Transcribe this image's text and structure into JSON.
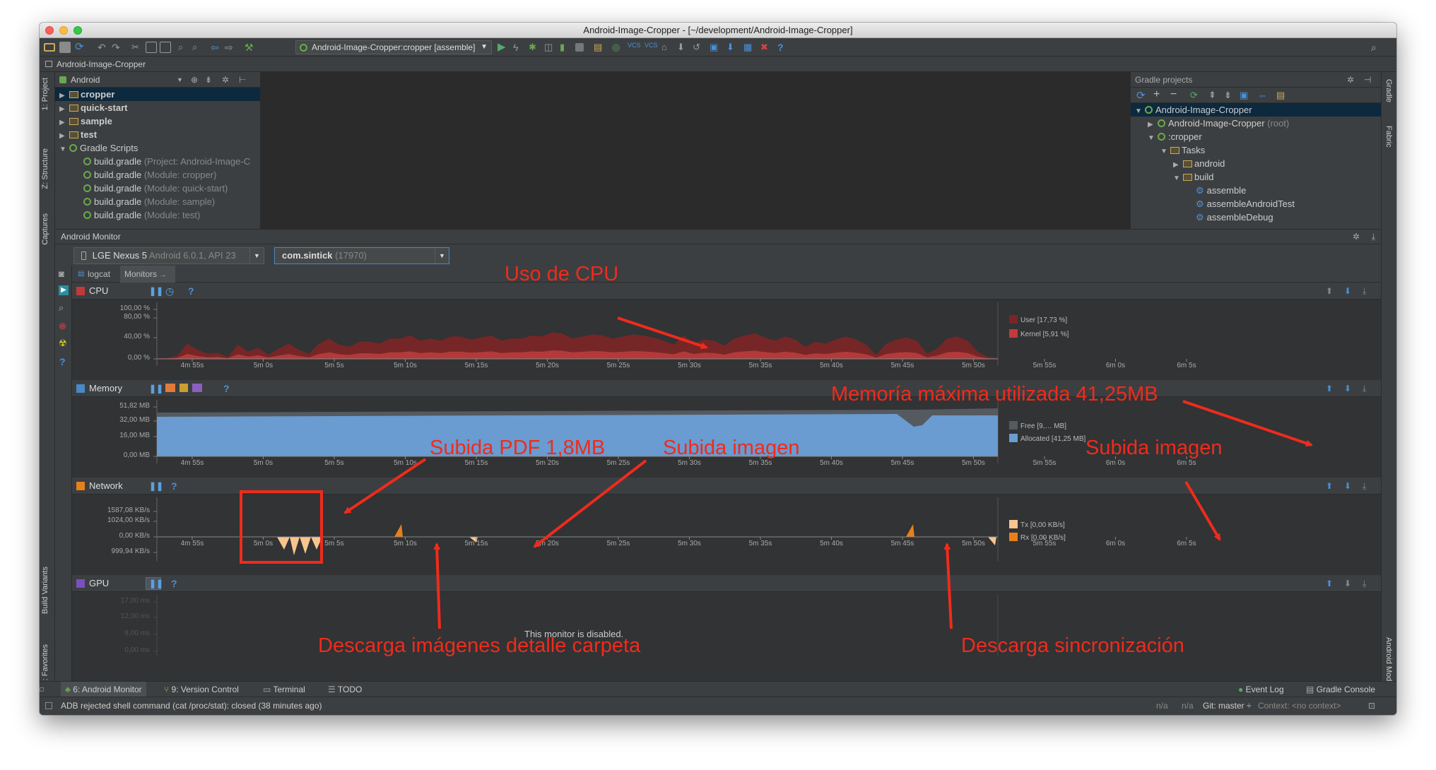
{
  "window": {
    "title": "Android-Image-Cropper - [~/development/Android-Image-Cropper]"
  },
  "toolbar": {
    "run_config": "Android-Image-Cropper:cropper [assemble]"
  },
  "navbar": {
    "breadcrumb": "Android-Image-Cropper"
  },
  "left_tabs": {
    "project": "1: Project",
    "structure": "Z: Structure",
    "captures": "Captures",
    "build_variants": "Build Variants",
    "favorites": "2: Favorites"
  },
  "right_tabs": {
    "gradle": "Gradle",
    "fabric": "Fabric",
    "android_model": "Android Model"
  },
  "project": {
    "view": "Android",
    "items": [
      {
        "label": "cropper",
        "type": "folder",
        "level": 0,
        "bold": true,
        "selected": true
      },
      {
        "label": "quick-start",
        "type": "folder",
        "level": 0,
        "bold": true
      },
      {
        "label": "sample",
        "type": "folder",
        "level": 0,
        "bold": true
      },
      {
        "label": "test",
        "type": "folder",
        "level": 0,
        "bold": true
      },
      {
        "label": "Gradle Scripts",
        "type": "gradle",
        "level": 0,
        "expanded": true
      },
      {
        "label": "build.gradle",
        "note": "(Project: Android-Image-C",
        "type": "gradle",
        "level": 1
      },
      {
        "label": "build.gradle",
        "note": "(Module: cropper)",
        "type": "gradle",
        "level": 1
      },
      {
        "label": "build.gradle",
        "note": "(Module: quick-start)",
        "type": "gradle",
        "level": 1
      },
      {
        "label": "build.gradle",
        "note": "(Module: sample)",
        "type": "gradle",
        "level": 1
      },
      {
        "label": "build.gradle",
        "note": "(Module: test)",
        "type": "gradle",
        "level": 1
      }
    ]
  },
  "gradle": {
    "title": "Gradle projects",
    "items": [
      {
        "label": "Android-Image-Cropper",
        "level": 0,
        "type": "gradle",
        "arrow": "down",
        "selected": true
      },
      {
        "label": "Android-Image-Cropper",
        "note": "(root)",
        "level": 1,
        "type": "gradle",
        "arrow": "right"
      },
      {
        "label": ":cropper",
        "level": 1,
        "type": "gradle",
        "arrow": "down"
      },
      {
        "label": "Tasks",
        "level": 2,
        "type": "folder",
        "arrow": "down"
      },
      {
        "label": "android",
        "level": 3,
        "type": "folder",
        "arrow": "right"
      },
      {
        "label": "build",
        "level": 3,
        "type": "folder",
        "arrow": "down"
      },
      {
        "label": "assemble",
        "level": 4,
        "type": "task"
      },
      {
        "label": "assembleAndroidTest",
        "level": 4,
        "type": "task"
      },
      {
        "label": "assembleDebug",
        "level": 4,
        "type": "task"
      }
    ]
  },
  "monitor": {
    "title": "Android Monitor",
    "device": "LGE Nexus 5",
    "device_detail": "Android 6.0.1, API 23",
    "process": "com.sintick",
    "process_pid": "(17970)",
    "tab_logcat": "logcat",
    "tab_monitors": "Monitors"
  },
  "x_ticks": [
    "4m 55s",
    "5m 0s",
    "5m 5s",
    "5m 10s",
    "5m 15s",
    "5m 20s",
    "5m 25s",
    "5m 30s",
    "5m 35s",
    "5m 40s",
    "5m 45s",
    "5m 50s",
    "5m 55s",
    "6m 0s",
    "6m 5s"
  ],
  "cpu": {
    "title": "CPU",
    "y_ticks": [
      "100,00 %",
      "80,00 %",
      "40,00 %",
      "0,00 %"
    ],
    "legend_user": "User [17,73 %]",
    "legend_kernel": "Kernel [5,91 %]",
    "color": "#8b2a2a"
  },
  "memory": {
    "title": "Memory",
    "y_ticks": [
      "51,82 MB",
      "32,00 MB",
      "16,00 MB",
      "0,00 MB"
    ],
    "legend_free": "Free [9,… MB]",
    "legend_allocated": "Allocated [41,25 MB]",
    "color": "#6a9bd1"
  },
  "network": {
    "title": "Network",
    "y_ticks": [
      "1587,08 KB/s",
      "1024,00 KB/s",
      "0,00 KB/s",
      "999,94 KB/s"
    ],
    "legend_tx": "Tx [0,00 KB/s]",
    "legend_rx": "Rx [0,00 KB/s]",
    "tx_color": "#f8c58f",
    "rx_color": "#e8801a"
  },
  "gpu": {
    "title": "GPU",
    "y_ticks": [
      "17,00 ms",
      "12,00 ms",
      "8,00 ms",
      "0,00 ms"
    ],
    "disabled": "This monitor is disabled."
  },
  "annotations": {
    "cpu": "Uso de CPU",
    "memory_max": "Memoría máxima utilizada 41,25MB",
    "pdf": "Subida PDF 1,8MB",
    "upload1": "Subida imagen",
    "upload2": "Subida imagen",
    "download_folder": "Descarga imágenes detalle carpeta",
    "download_sync": "Descarga sincronización",
    "color": "#ef2b1c"
  },
  "bottom_tabs": {
    "monitor": "6: Android Monitor",
    "vcs": "9: Version Control",
    "terminal": "Terminal",
    "todo": "TODO",
    "event_log": "Event Log",
    "gradle_console": "Gradle Console"
  },
  "status": {
    "message": "ADB rejected shell command (cat /proc/stat): closed (38 minutes ago)",
    "na1": "n/a",
    "na2": "n/a",
    "git": "Git: master ÷",
    "context": "Context: <no context>"
  }
}
